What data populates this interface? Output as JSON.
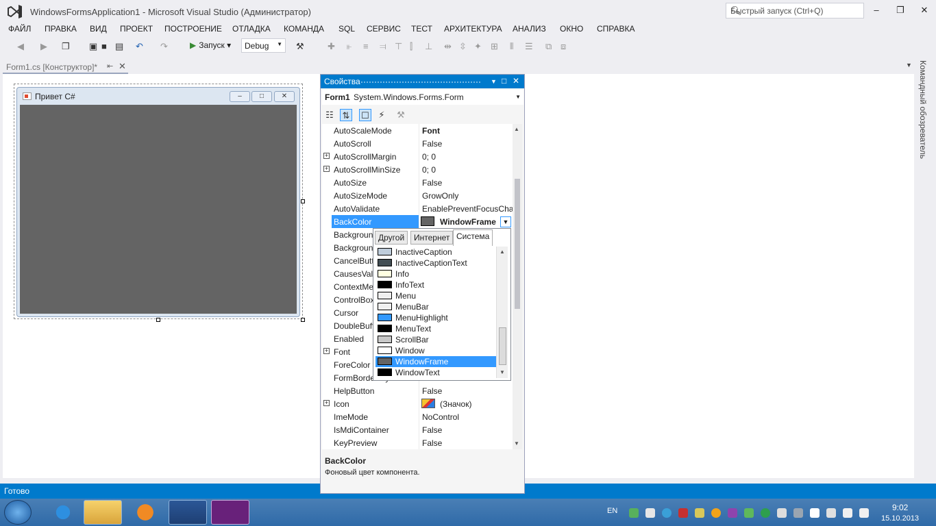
{
  "window": {
    "title": "WindowsFormsApplication1 - Microsoft Visual Studio (Администратор)",
    "quick_launch_placeholder": "Быстрый запуск (Ctrl+Q)"
  },
  "menu": [
    "ФАЙЛ",
    "ПРАВКА",
    "ВИД",
    "ПРОЕКТ",
    "ПОСТРОЕНИЕ",
    "ОТЛАДКА",
    "КОМАНДА",
    "SQL",
    "СЕРВИС",
    "ТЕСТ",
    "АРХИТЕКТУРА",
    "АНАЛИЗ",
    "ОКНО",
    "СПРАВКА"
  ],
  "toolbar": {
    "run_label": "Запуск",
    "config": "Debug"
  },
  "doc_tab": {
    "label": "Form1.cs [Конструктор]*"
  },
  "form": {
    "title": "Привет C#",
    "back_color": "#646464"
  },
  "right_panel": {
    "label": "Командный обозреватель"
  },
  "status": {
    "text": "Готово"
  },
  "properties": {
    "title": "Свойства",
    "object_name": "Form1",
    "object_type": "System.Windows.Forms.Form",
    "rows": [
      {
        "name": "AutoScaleMode",
        "value": "Font",
        "bold": true,
        "expand": false
      },
      {
        "name": "AutoScroll",
        "value": "False",
        "expand": false
      },
      {
        "name": "AutoScrollMargin",
        "value": "0; 0",
        "expand": true
      },
      {
        "name": "AutoScrollMinSize",
        "value": "0; 0",
        "expand": true
      },
      {
        "name": "AutoSize",
        "value": "False",
        "expand": false
      },
      {
        "name": "AutoSizeMode",
        "value": "GrowOnly",
        "expand": false
      },
      {
        "name": "AutoValidate",
        "value": "EnablePreventFocusChange",
        "expand": false
      },
      {
        "name": "BackColor",
        "value": "",
        "expand": false,
        "selected": true
      },
      {
        "name": "BackgroundImage",
        "value": "",
        "expand": false
      },
      {
        "name": "BackgroundImageLayout",
        "value": "",
        "expand": false
      },
      {
        "name": "CancelButton",
        "value": "",
        "expand": false
      },
      {
        "name": "CausesValidation",
        "value": "",
        "expand": false
      },
      {
        "name": "ContextMenuStrip",
        "value": "",
        "expand": false
      },
      {
        "name": "ControlBox",
        "value": "",
        "expand": false
      },
      {
        "name": "Cursor",
        "value": "",
        "expand": false
      },
      {
        "name": "DoubleBuffered",
        "value": "",
        "expand": false
      },
      {
        "name": "Enabled",
        "value": "",
        "expand": false
      },
      {
        "name": "Font",
        "value": "",
        "expand": true
      },
      {
        "name": "ForeColor",
        "value": "",
        "expand": false
      },
      {
        "name": "FormBorderStyle",
        "value": "",
        "expand": false
      },
      {
        "name": "HelpButton",
        "value": "False",
        "expand": false
      },
      {
        "name": "Icon",
        "value": "(Значок)",
        "expand": true
      },
      {
        "name": "ImeMode",
        "value": "NoControl",
        "expand": false
      },
      {
        "name": "IsMdiContainer",
        "value": "False",
        "expand": false
      },
      {
        "name": "KeyPreview",
        "value": "False",
        "expand": false
      }
    ],
    "backcolor_value": "WindowFrame",
    "description_title": "BackColor",
    "description_text": "Фоновый цвет компонента."
  },
  "color_popup": {
    "tabs": [
      "Другой",
      "Интернет",
      "Система"
    ],
    "active_tab": "Система",
    "items": [
      {
        "name": "InactiveCaption",
        "color": "#bfcddb"
      },
      {
        "name": "InactiveCaptionText",
        "color": "#434e54"
      },
      {
        "name": "Info",
        "color": "#ffffe1"
      },
      {
        "name": "InfoText",
        "color": "#000000"
      },
      {
        "name": "Menu",
        "color": "#f0f0f0"
      },
      {
        "name": "MenuBar",
        "color": "#f0f0f0"
      },
      {
        "name": "MenuHighlight",
        "color": "#3399ff"
      },
      {
        "name": "MenuText",
        "color": "#000000"
      },
      {
        "name": "ScrollBar",
        "color": "#c8c8c8"
      },
      {
        "name": "Window",
        "color": "#ffffff"
      },
      {
        "name": "WindowFrame",
        "color": "#646464",
        "selected": true
      },
      {
        "name": "WindowText",
        "color": "#000000"
      }
    ]
  },
  "taskbar": {
    "lang": "EN",
    "time": "9:02",
    "date": "15.10.2013"
  }
}
